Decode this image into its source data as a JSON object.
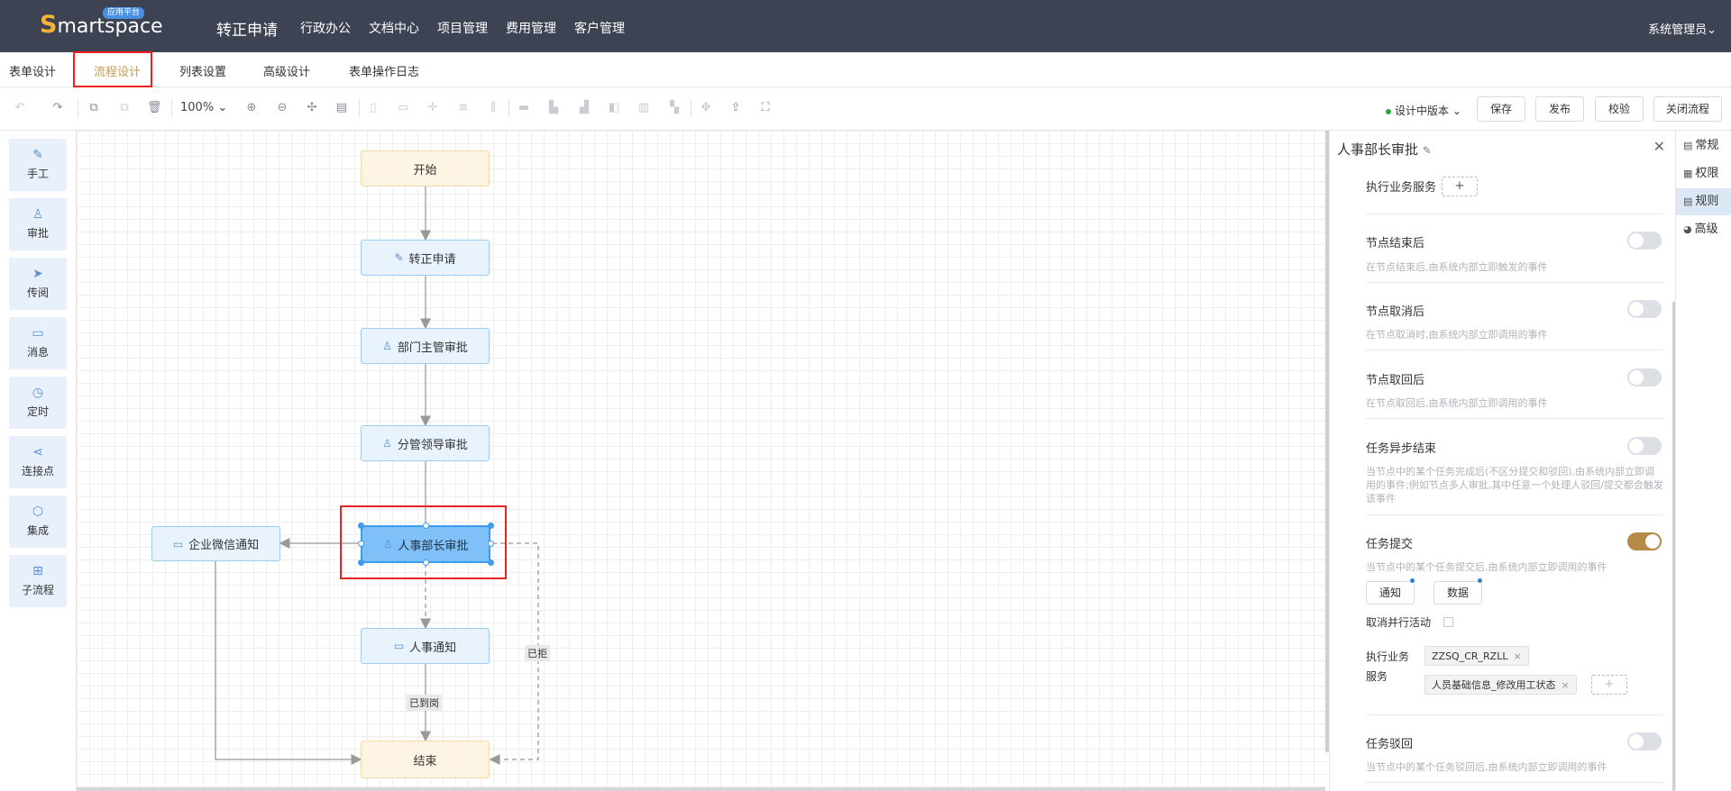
{
  "topbar": {
    "logo_s": "S",
    "logo_rest": "martspace",
    "logo_badge": "应用平台",
    "app_title": "转正申请",
    "nav": [
      "行政办公",
      "文档中心",
      "项目管理",
      "费用管理",
      "客户管理"
    ],
    "user": "系统管理员"
  },
  "tabs": [
    "表单设计",
    "流程设计",
    "列表设置",
    "高级设计",
    "表单操作日志"
  ],
  "active_tab": "流程设计",
  "toolbar": {
    "zoom": "100%",
    "version": "设计中版本",
    "buttons": [
      "保存",
      "发布",
      "校验",
      "关闭流程"
    ]
  },
  "palette": [
    "手工",
    "审批",
    "传阅",
    "消息",
    "定时",
    "连接点",
    "集成",
    "子流程"
  ],
  "flow": {
    "nodes": [
      "开始",
      "转正申请",
      "部门主管审批",
      "分管领导审批",
      "人事部长审批",
      "企业微信通知",
      "人事通知",
      "结束"
    ],
    "edge_labels": [
      "已拒",
      "已到岗"
    ]
  },
  "panel": {
    "title": "人事部长审批",
    "exec_service_top": "执行业务服务",
    "rows": [
      {
        "label": "节点结束后",
        "desc": "在节点结束后,由系统内部立即触发的事件"
      },
      {
        "label": "节点取消后",
        "desc": "在节点取消时,由系统内部立即调用的事件"
      },
      {
        "label": "节点取回后",
        "desc": "在节点取回后,由系统内部立即调用的事件"
      },
      {
        "label": "任务异步结束",
        "desc": "当节点中的某个任务完成后(不区分提交和驳回),由系统内部立即调用的事件;例如节点多人审批,其中任意一个处理人驳回/提交都会触发该事件"
      },
      {
        "label": "任务提交",
        "desc": "当节点中的某个任务提交后,由系统内部立即调用的事件"
      }
    ],
    "task_submit_on": true,
    "buttons": [
      "通知",
      "数据"
    ],
    "cancel_parallel": "取消并行活动",
    "exec_service_label": "执行业务服务",
    "services": [
      "ZZSQ_CR_RZLL",
      "人员基础信息_修改用工状态"
    ],
    "task_reject": {
      "label": "任务驳回",
      "desc": "当节点中的某个任务驳回后,由系统内部立即调用的事件"
    }
  },
  "side_tabs": [
    "常规",
    "权限",
    "规则",
    "高级"
  ],
  "active_side_tab": "规则"
}
